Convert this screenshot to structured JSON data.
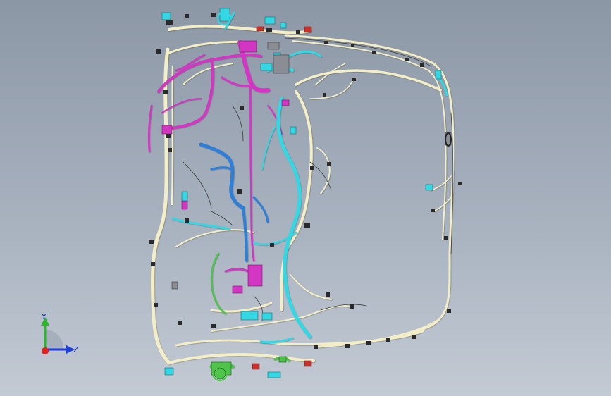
{
  "view": {
    "colors": {
      "background_top": "#8c97a6",
      "background_bottom": "#c3cad4",
      "harness_main": "#f3eec6",
      "harness_magenta": "#d436c4",
      "harness_cyan": "#33d8e4",
      "harness_blue": "#2e7fd8",
      "harness_green": "#4ec44a",
      "connector_dark": "#2a2a2a",
      "connector_red": "#c8312a"
    }
  },
  "triad": {
    "y_label": "Y",
    "z_label": "Z",
    "x_axis_color": "#e02020",
    "y_axis_color": "#2bb52b",
    "z_axis_color": "#1f3fd6"
  }
}
